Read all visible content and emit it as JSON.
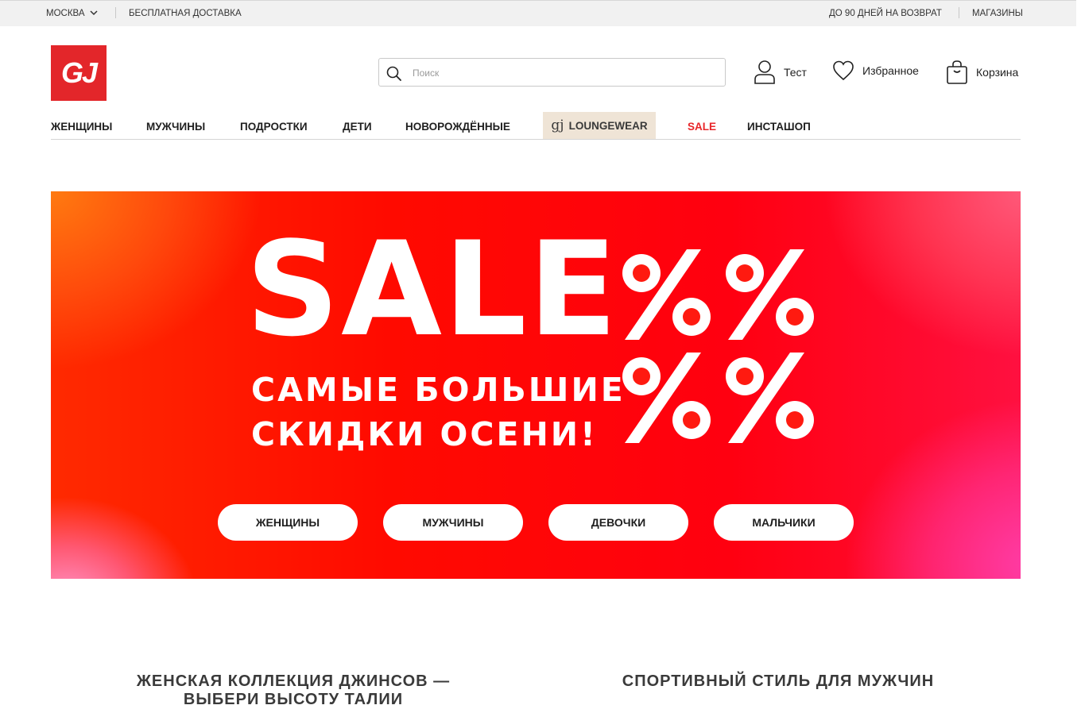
{
  "topbar": {
    "city": "МОСКВА",
    "free_delivery": "БЕСПЛАТНАЯ ДОСТАВКА",
    "returns": "ДО 90 ДНЕЙ НА ВОЗВРАТ",
    "stores": "МАГАЗИНЫ"
  },
  "header": {
    "logo_text": "GJ",
    "search_placeholder": "Поиск",
    "account_label": "Тест",
    "favorites_label": "Избранное",
    "cart_label": "Корзина"
  },
  "nav": {
    "women": "ЖЕНЩИНЫ",
    "men": "МУЖЧИНЫ",
    "teens": "ПОДРОСТКИ",
    "kids": "ДЕТИ",
    "newborns": "НОВОРОЖДЁННЫЕ",
    "lounge_mark": "gj",
    "lounge": "LOUNGEWEAR",
    "sale": "SALE",
    "instashop": "ИНСТАШОП"
  },
  "banner": {
    "title": "SALE",
    "subtitle_line1": "САМЫЕ БОЛЬШИЕ",
    "subtitle_line2": "СКИДКИ ОСЕНИ!",
    "buttons": [
      "ЖЕНЩИНЫ",
      "МУЖЧИНЫ",
      "ДЕВОЧКИ",
      "МАЛЬЧИКИ"
    ]
  },
  "promos": {
    "left_line1": "ЖЕНСКАЯ КОЛЛЕКЦИЯ ДЖИНСОВ —",
    "left_line2": "ВЫБЕРИ ВЫСОТУ ТАЛИИ",
    "right": "СПОРТИВНЫЙ СТИЛЬ ДЛЯ МУЖЧИН"
  },
  "colors": {
    "brand_red": "#e3262a",
    "sale_red": "#e8262a",
    "lounge_bg": "#efe4d6"
  }
}
